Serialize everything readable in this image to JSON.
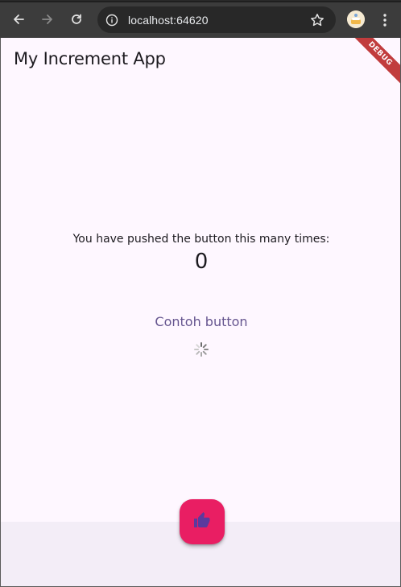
{
  "browser": {
    "url": "localhost:64620",
    "icons": {
      "back": "arrow-left-icon",
      "forward": "arrow-right-icon",
      "reload": "reload-icon",
      "site_info": "info-icon",
      "bookmark": "star-icon",
      "profile": "profile-avatar-icon",
      "menu": "kebab-menu-icon"
    }
  },
  "app": {
    "title": "My Increment App",
    "debug_banner": "DEBUG",
    "counter_label": "You have pushed the button this many times:",
    "counter_value": "0",
    "text_button_label": "Contoh button",
    "fab_icon": "thumb-up-icon",
    "colors": {
      "background": "#fef7ff",
      "bottom_bar": "#f3edf7",
      "fab": "#e91e63",
      "fab_icon": "#5b3a9e",
      "text_button": "#65558f",
      "debug_banner": "#b71c1c"
    }
  }
}
